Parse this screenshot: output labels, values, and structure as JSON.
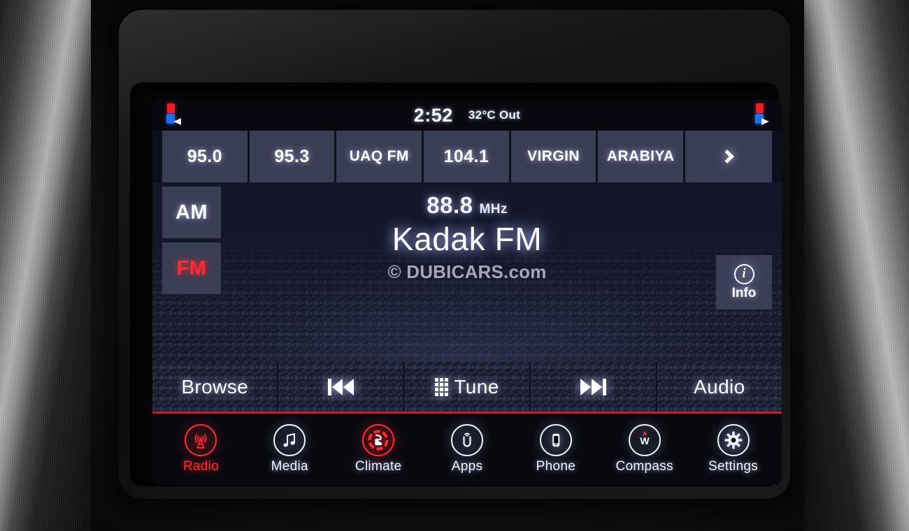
{
  "device": {
    "type": "car-infotainment-touchscreen",
    "accent_red": "#ff2b30",
    "screen_bg": "#14172a",
    "tile_bg": "#3a3e55"
  },
  "status_bar": {
    "clock": "2:52",
    "temperature": "32°C Out",
    "left_indicator": "seat-climate-indicator",
    "right_indicator": "seat-climate-indicator"
  },
  "presets": [
    {
      "label": "95.0",
      "size": "large"
    },
    {
      "label": "95.3",
      "size": "large"
    },
    {
      "label": "UAQ FM",
      "size": "small"
    },
    {
      "label": "104.1",
      "size": "large"
    },
    {
      "label": "VIRGIN",
      "size": "small"
    },
    {
      "label": "ARABIYA",
      "size": "small"
    }
  ],
  "preset_more": {
    "icon": "chevron-right-icon",
    "label": ""
  },
  "bands": [
    {
      "label": "AM",
      "active": false
    },
    {
      "label": "FM",
      "active": true
    }
  ],
  "now_playing": {
    "frequency": "88.8",
    "unit": "MHz",
    "station": "Kadak FM"
  },
  "watermark": {
    "text": "© DUBICARS.com"
  },
  "info_button": {
    "glyph": "i",
    "label": "Info"
  },
  "control_bar": {
    "browse": "Browse",
    "prev": "seek-down-icon",
    "tune": "Tune",
    "next": "seek-up-icon",
    "audio": "Audio"
  },
  "nav_bar": [
    {
      "label": "Radio",
      "icon": "radio-tower-icon",
      "active": true
    },
    {
      "label": "Media",
      "icon": "music-note-icon",
      "active": false
    },
    {
      "label": "Climate",
      "icon": "climate-seat-icon",
      "active": true
    },
    {
      "label": "Apps",
      "icon": "uconnect-icon",
      "active": false
    },
    {
      "label": "Phone",
      "icon": "phone-icon",
      "active": false
    },
    {
      "label": "Compass",
      "icon": "compass-icon",
      "active": false
    },
    {
      "label": "Settings",
      "icon": "gear-icon",
      "active": false
    }
  ],
  "compass_heading": "W"
}
